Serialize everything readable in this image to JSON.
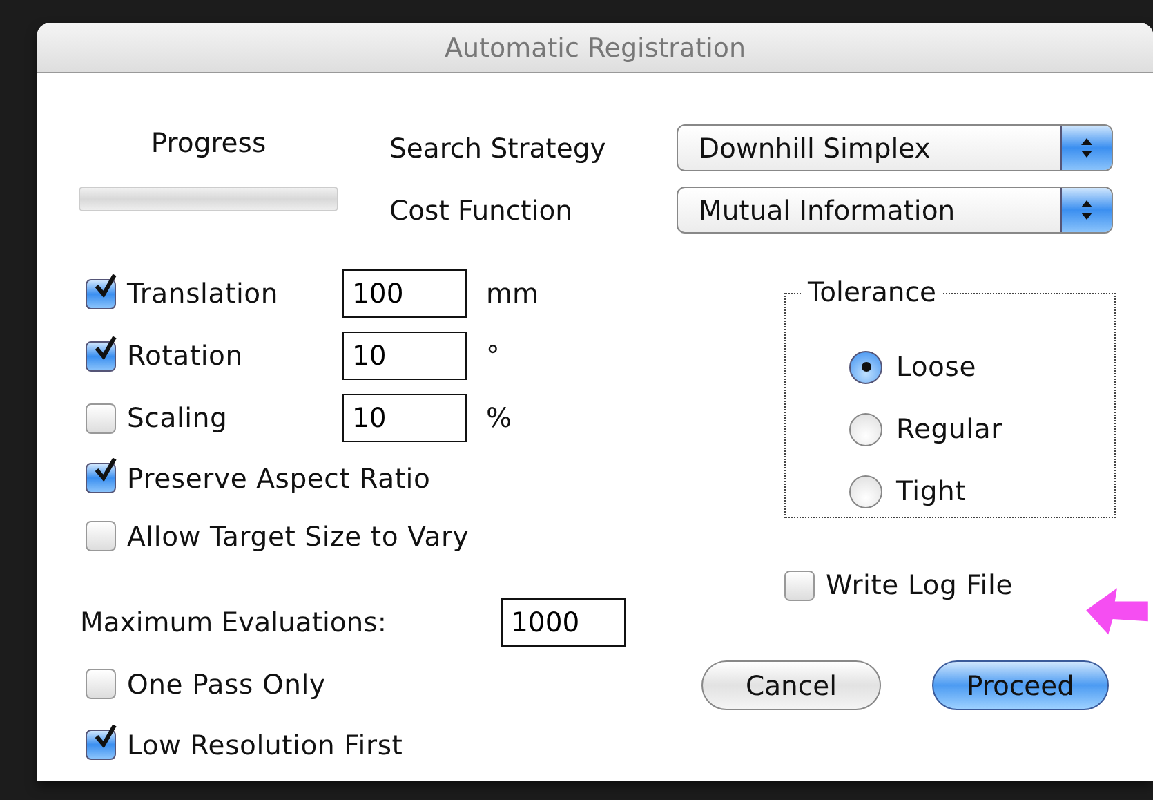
{
  "window": {
    "title": "Automatic Registration"
  },
  "progress": {
    "label": "Progress",
    "level": 0
  },
  "popups": [
    {
      "label": "Search Strategy",
      "value": "Downhill Simplex"
    },
    {
      "label": "Cost Function",
      "value": "Mutual Information"
    }
  ],
  "options": [
    {
      "kind": "checkbox",
      "label": "Translation",
      "checked": true,
      "value": "100",
      "unit": "mm"
    },
    {
      "kind": "checkbox",
      "label": "Rotation",
      "checked": true,
      "value": "10",
      "unit": "°"
    },
    {
      "kind": "checkbox",
      "label": "Scaling",
      "checked": false,
      "value": "10",
      "unit": "%"
    },
    {
      "kind": "checkbox",
      "label": "Preserve Aspect Ratio",
      "checked": true
    },
    {
      "kind": "checkbox",
      "label": "Allow Target Size to Vary",
      "checked": false
    },
    {
      "kind": "field",
      "label": "Maximum Evaluations:",
      "value": "1000"
    },
    {
      "kind": "checkbox",
      "label": "One Pass Only",
      "checked": false
    },
    {
      "kind": "checkbox",
      "label": "Low Resolution First",
      "checked": true
    }
  ],
  "tolerance": {
    "title": "Tolerance",
    "options": [
      {
        "label": "Loose",
        "selected": true
      },
      {
        "label": "Regular",
        "selected": false
      },
      {
        "label": "Tight",
        "selected": false
      }
    ]
  },
  "write_log": {
    "label": "Write Log File",
    "checked": false
  },
  "buttons": [
    {
      "label": "Cancel",
      "default": false
    },
    {
      "label": "Proceed",
      "default": true
    }
  ]
}
